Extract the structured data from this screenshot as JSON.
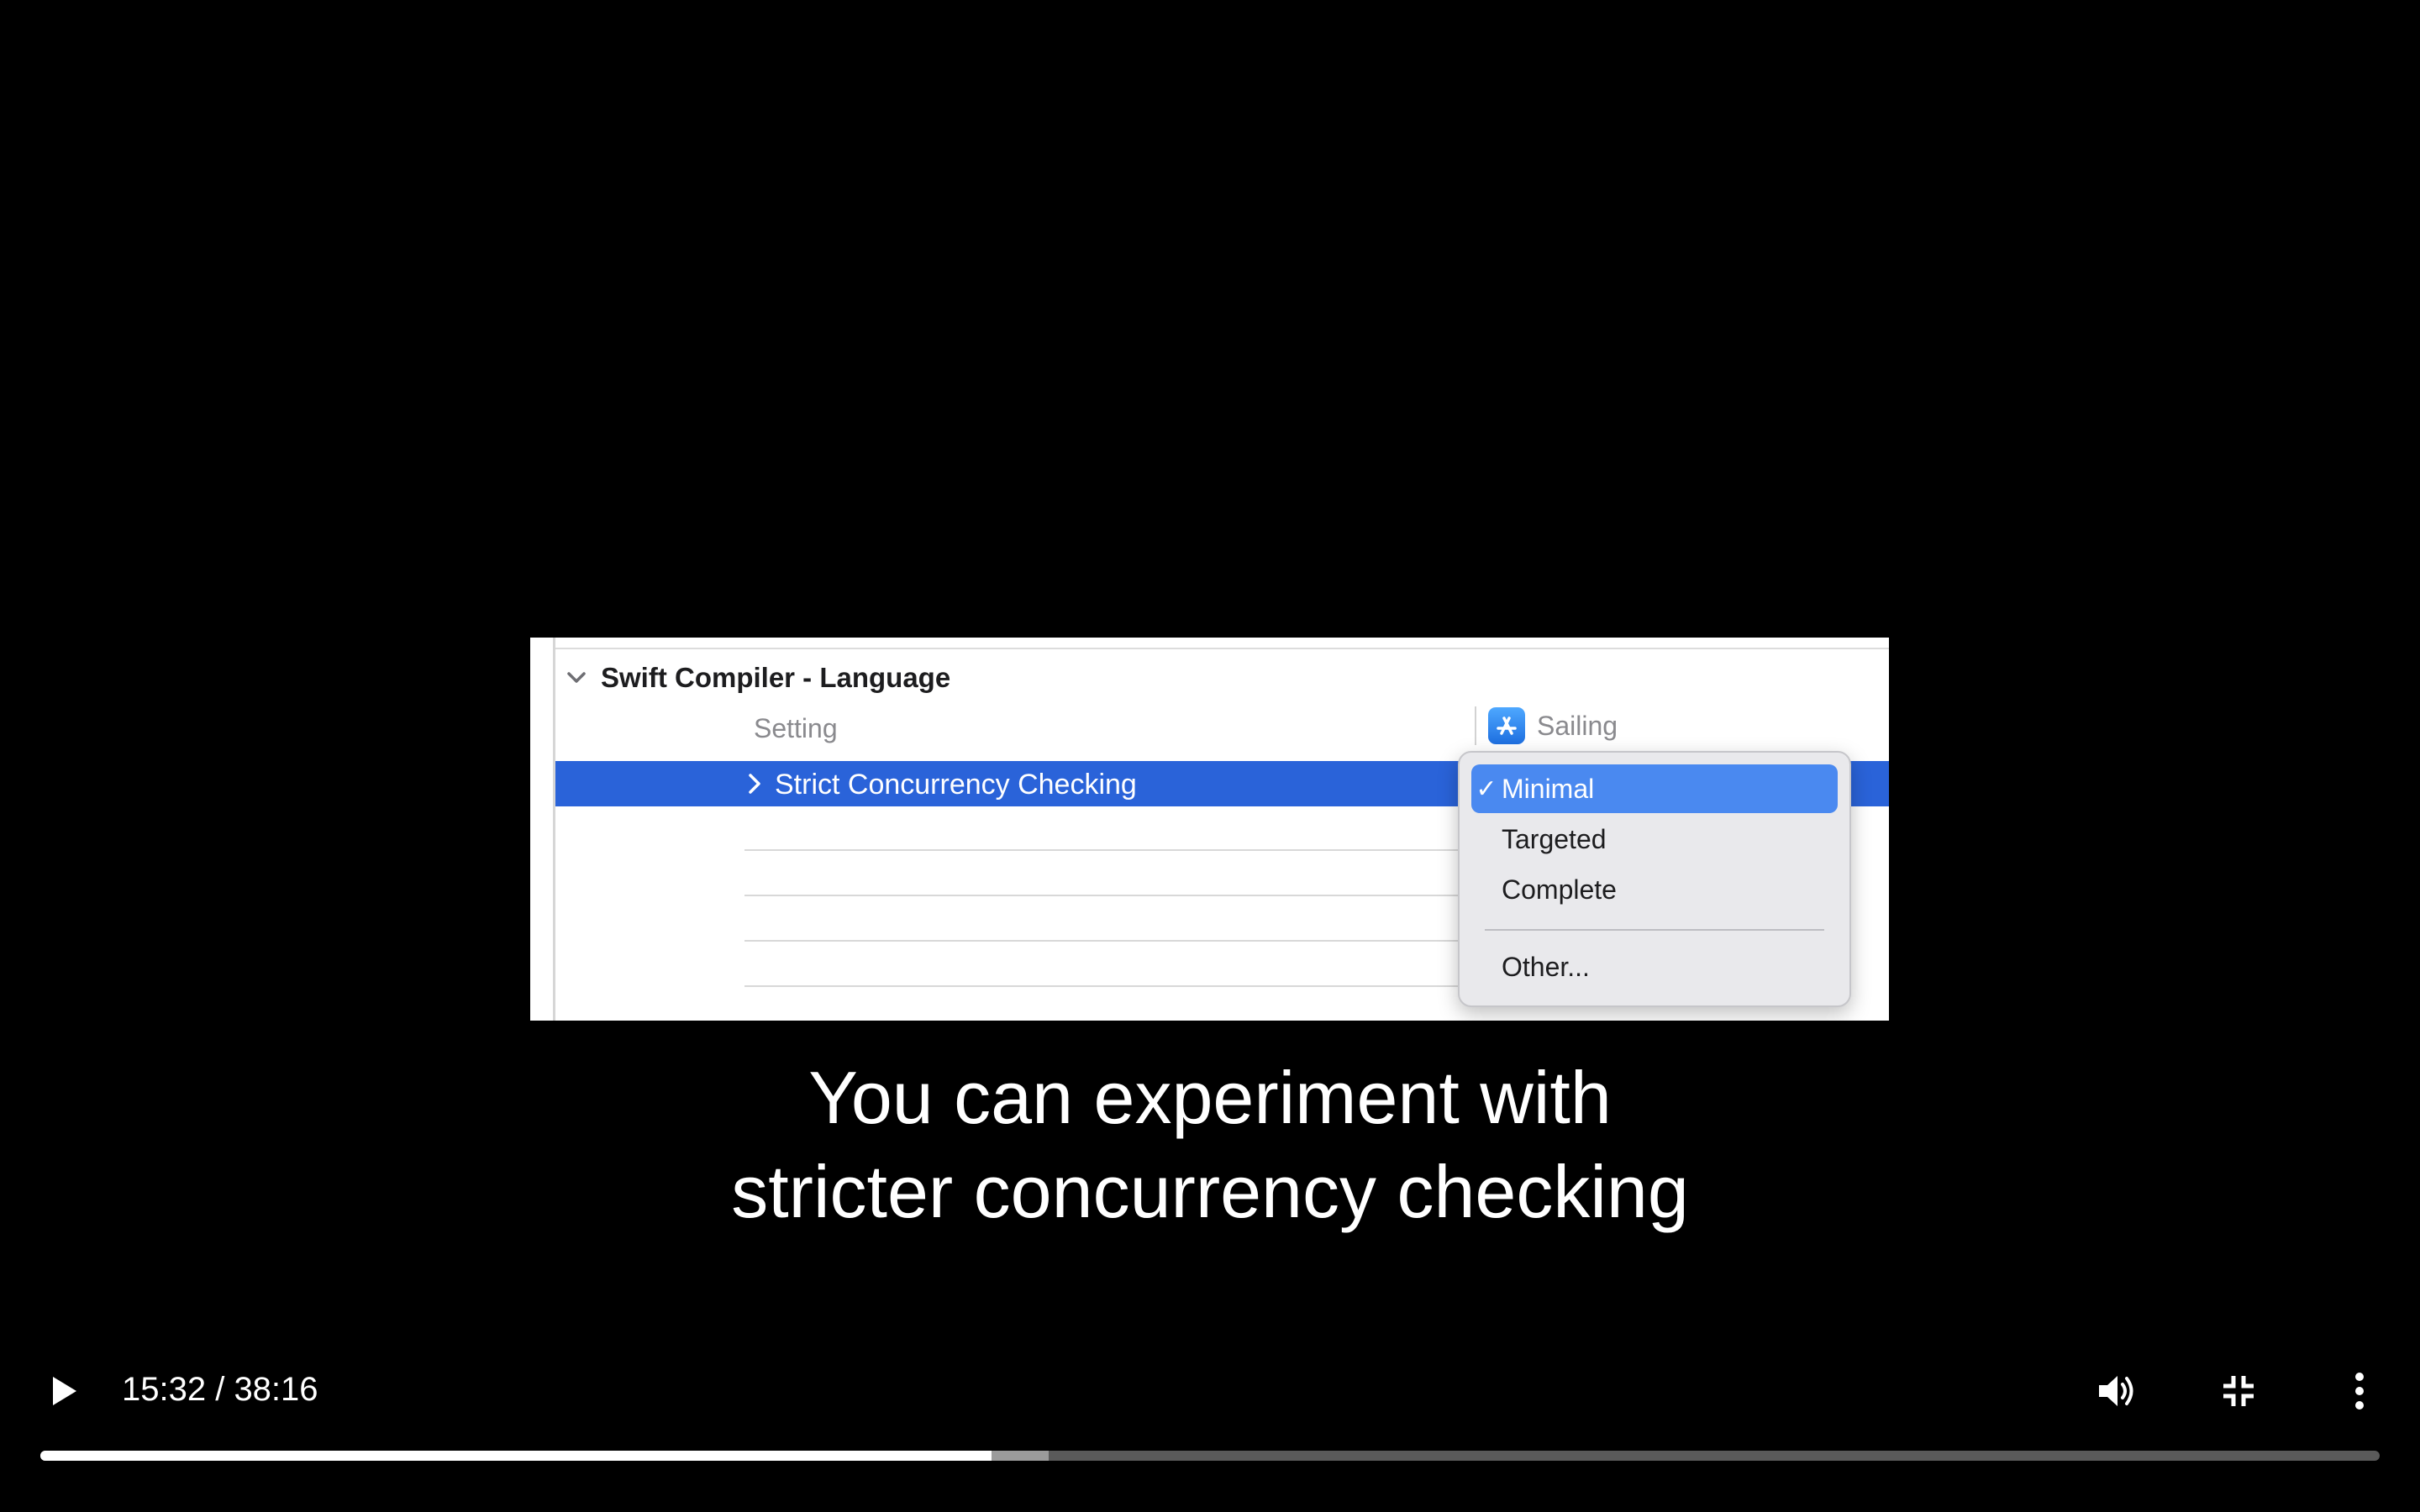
{
  "video_frame": {
    "section_title": "Swift Compiler - Language",
    "column_setting": "Setting",
    "target_name": "Sailing",
    "selected_row_label": "Strict Concurrency Checking",
    "menu": {
      "items": [
        {
          "label": "Minimal",
          "checked": true
        },
        {
          "label": "Targeted",
          "checked": false
        },
        {
          "label": "Complete",
          "checked": false
        }
      ],
      "other_label": "Other...",
      "check_glyph": "✓"
    }
  },
  "subtitles": {
    "line1": "You can experiment with",
    "line2": "stricter concurrency checking"
  },
  "player": {
    "time_display": "15:32 / 38:16",
    "current_time": "15:32",
    "duration": "38:16",
    "progress_fraction": 0.4066,
    "buffered_fraction": 0.431,
    "icons": {
      "play": "play-icon",
      "volume": "volume-icon",
      "exit_fullscreen": "exit-fullscreen-icon",
      "more": "more-vertical-icon"
    }
  },
  "colors": {
    "background": "#000000",
    "selection_blue": "#2a63d9",
    "menu_highlight": "#4a89f0"
  }
}
